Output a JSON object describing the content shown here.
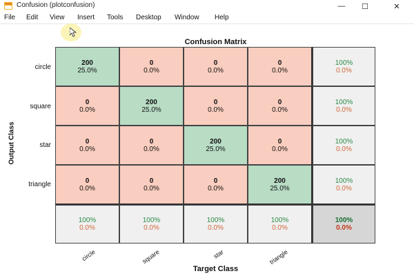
{
  "window": {
    "title": "Confusion (plotconfusion)",
    "minimize": "—",
    "maximize": "☐",
    "close": "✕"
  },
  "menu": [
    "File",
    "Edit",
    "View",
    "Insert",
    "Tools",
    "Desktop",
    "Window",
    "Help"
  ],
  "chart": {
    "title": "Confusion Matrix",
    "xlabel": "Target Class",
    "ylabel": "Output Class",
    "classes": [
      "circle",
      "square",
      "star",
      "triangle"
    ]
  },
  "matrix": {
    "rows": [
      [
        {
          "count": "200",
          "pct": "25.0%"
        },
        {
          "count": "0",
          "pct": "0.0%"
        },
        {
          "count": "0",
          "pct": "0.0%"
        },
        {
          "count": "0",
          "pct": "0.0%"
        }
      ],
      [
        {
          "count": "0",
          "pct": "0.0%"
        },
        {
          "count": "200",
          "pct": "25.0%"
        },
        {
          "count": "0",
          "pct": "0.0%"
        },
        {
          "count": "0",
          "pct": "0.0%"
        }
      ],
      [
        {
          "count": "0",
          "pct": "0.0%"
        },
        {
          "count": "0",
          "pct": "0.0%"
        },
        {
          "count": "200",
          "pct": "25.0%"
        },
        {
          "count": "0",
          "pct": "0.0%"
        }
      ],
      [
        {
          "count": "0",
          "pct": "0.0%"
        },
        {
          "count": "0",
          "pct": "0.0%"
        },
        {
          "count": "0",
          "pct": "0.0%"
        },
        {
          "count": "200",
          "pct": "25.0%"
        }
      ]
    ],
    "row_summary": [
      {
        "good": "100%",
        "bad": "0.0%"
      },
      {
        "good": "100%",
        "bad": "0.0%"
      },
      {
        "good": "100%",
        "bad": "0.0%"
      },
      {
        "good": "100%",
        "bad": "0.0%"
      }
    ],
    "col_summary": [
      {
        "good": "100%",
        "bad": "0.0%"
      },
      {
        "good": "100%",
        "bad": "0.0%"
      },
      {
        "good": "100%",
        "bad": "0.0%"
      },
      {
        "good": "100%",
        "bad": "0.0%"
      }
    ],
    "total": {
      "good": "100%",
      "bad": "0.0%"
    }
  },
  "colors": {
    "correct_cell": "#b8dcc4",
    "incorrect_cell": "#f9cdbf",
    "summary_cell": "#f0f0f0",
    "total_cell": "#d6d6d6",
    "good_text": "#2c8a45",
    "bad_text": "#d0683c"
  },
  "chart_data": {
    "type": "heatmap",
    "title": "Confusion Matrix",
    "xlabel": "Target Class",
    "ylabel": "Output Class",
    "x": [
      "circle",
      "square",
      "star",
      "triangle"
    ],
    "y": [
      "circle",
      "square",
      "star",
      "triangle"
    ],
    "values": [
      [
        200,
        0,
        0,
        0
      ],
      [
        0,
        200,
        0,
        0
      ],
      [
        0,
        0,
        200,
        0
      ],
      [
        0,
        0,
        0,
        200
      ]
    ],
    "percentages": [
      [
        25.0,
        0.0,
        0.0,
        0.0
      ],
      [
        0.0,
        25.0,
        0.0,
        0.0
      ],
      [
        0.0,
        0.0,
        25.0,
        0.0
      ],
      [
        0.0,
        0.0,
        0.0,
        25.0
      ]
    ],
    "row_accuracy": [
      100,
      100,
      100,
      100
    ],
    "col_accuracy": [
      100,
      100,
      100,
      100
    ],
    "overall_accuracy": 100
  }
}
